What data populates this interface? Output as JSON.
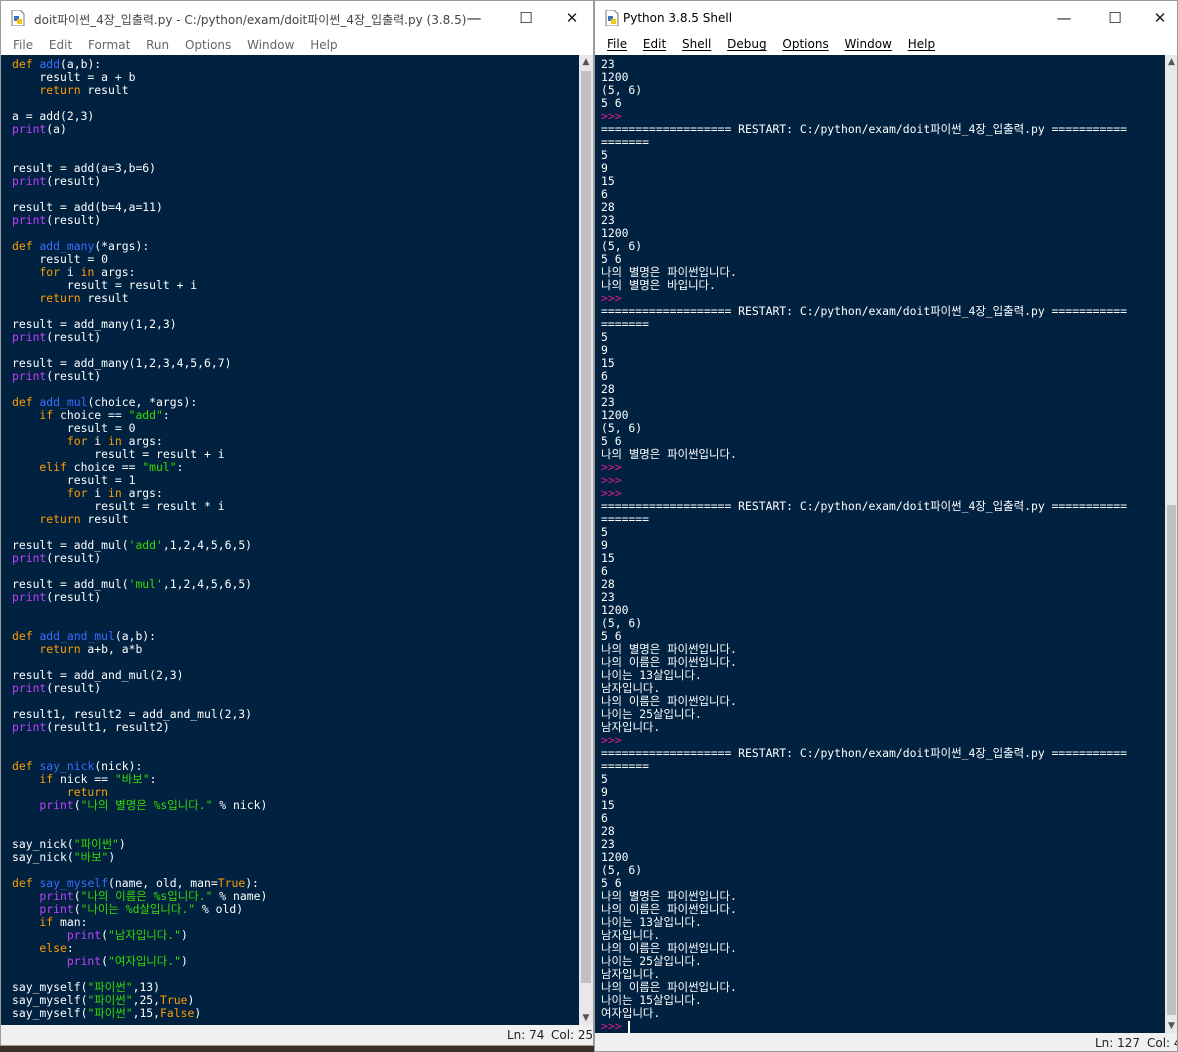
{
  "editor": {
    "title": "doit파이썬_4장_입출력.py - C:/python/exam/doit파이썬_4장_입출력.py (3.8.5)",
    "menu": [
      "File",
      "Edit",
      "Format",
      "Run",
      "Options",
      "Window",
      "Help"
    ],
    "status_ln": "Ln: 74",
    "status_col": "Col: 25",
    "code_lines": [
      [
        [
          "kw",
          "def "
        ],
        [
          "fn",
          "add"
        ],
        [
          "",
          "(a,b):"
        ]
      ],
      [
        [
          "",
          "    result = a + b"
        ]
      ],
      [
        [
          "kw",
          "    return"
        ],
        [
          "",
          " result"
        ]
      ],
      [],
      [
        [
          "",
          "a = add(2,3)"
        ]
      ],
      [
        [
          "bi",
          "print"
        ],
        [
          "",
          "(a)"
        ]
      ],
      [],
      [],
      [
        [
          "",
          "result = add(a=3,b=6)"
        ]
      ],
      [
        [
          "bi",
          "print"
        ],
        [
          "",
          "(result)"
        ]
      ],
      [],
      [
        [
          "",
          "result = add(b=4,a=11)"
        ]
      ],
      [
        [
          "bi",
          "print"
        ],
        [
          "",
          "(result)"
        ]
      ],
      [],
      [
        [
          "kw",
          "def "
        ],
        [
          "fn",
          "add_many"
        ],
        [
          "",
          "(*args):"
        ]
      ],
      [
        [
          "",
          "    result = 0"
        ]
      ],
      [
        [
          "kw",
          "    for"
        ],
        [
          "",
          " i "
        ],
        [
          "kw",
          "in"
        ],
        [
          "",
          " args:"
        ]
      ],
      [
        [
          "",
          "        result = result + i"
        ]
      ],
      [
        [
          "kw",
          "    return"
        ],
        [
          "",
          " result"
        ]
      ],
      [],
      [
        [
          "",
          "result = add_many(1,2,3)"
        ]
      ],
      [
        [
          "bi",
          "print"
        ],
        [
          "",
          "(result)"
        ]
      ],
      [],
      [
        [
          "",
          "result = add_many(1,2,3,4,5,6,7)"
        ]
      ],
      [
        [
          "bi",
          "print"
        ],
        [
          "",
          "(result)"
        ]
      ],
      [],
      [
        [
          "kw",
          "def "
        ],
        [
          "fn",
          "add_mul"
        ],
        [
          "",
          "(choice, *args):"
        ]
      ],
      [
        [
          "kw",
          "    if"
        ],
        [
          "",
          " choice == "
        ],
        [
          "str",
          "\"add\""
        ],
        [
          "",
          ":"
        ]
      ],
      [
        [
          "",
          "        result = 0"
        ]
      ],
      [
        [
          "kw",
          "        for"
        ],
        [
          "",
          " i "
        ],
        [
          "kw",
          "in"
        ],
        [
          "",
          " args:"
        ]
      ],
      [
        [
          "",
          "            result = result + i"
        ]
      ],
      [
        [
          "kw",
          "    elif"
        ],
        [
          "",
          " choice == "
        ],
        [
          "str",
          "\"mul\""
        ],
        [
          "",
          ":"
        ]
      ],
      [
        [
          "",
          "        result = 1"
        ]
      ],
      [
        [
          "kw",
          "        for"
        ],
        [
          "",
          " i "
        ],
        [
          "kw",
          "in"
        ],
        [
          "",
          " args:"
        ]
      ],
      [
        [
          "",
          "            result = result * i"
        ]
      ],
      [
        [
          "kw",
          "    return"
        ],
        [
          "",
          " result"
        ]
      ],
      [],
      [
        [
          "",
          "result = add_mul("
        ],
        [
          "str",
          "'add'"
        ],
        [
          "",
          ",1,2,4,5,6,5)"
        ]
      ],
      [
        [
          "bi",
          "print"
        ],
        [
          "",
          "(result)"
        ]
      ],
      [],
      [
        [
          "",
          "result = add_mul("
        ],
        [
          "str",
          "'mul'"
        ],
        [
          "",
          ",1,2,4,5,6,5)"
        ]
      ],
      [
        [
          "bi",
          "print"
        ],
        [
          "",
          "(result)"
        ]
      ],
      [],
      [],
      [
        [
          "kw",
          "def "
        ],
        [
          "fn",
          "add_and_mul"
        ],
        [
          "",
          "(a,b):"
        ]
      ],
      [
        [
          "kw",
          "    return"
        ],
        [
          "",
          " a+b, a*b"
        ]
      ],
      [],
      [
        [
          "",
          "result = add_and_mul(2,3)"
        ]
      ],
      [
        [
          "bi",
          "print"
        ],
        [
          "",
          "(result)"
        ]
      ],
      [],
      [
        [
          "",
          "result1, result2 = add_and_mul(2,3)"
        ]
      ],
      [
        [
          "bi",
          "print"
        ],
        [
          "",
          "(result1, result2)"
        ]
      ],
      [],
      [],
      [
        [
          "kw",
          "def "
        ],
        [
          "fn",
          "say_nick"
        ],
        [
          "",
          "(nick):"
        ]
      ],
      [
        [
          "kw",
          "    if"
        ],
        [
          "",
          " nick == "
        ],
        [
          "str",
          "\"바보\""
        ],
        [
          "",
          ":"
        ]
      ],
      [
        [
          "kw",
          "        return"
        ]
      ],
      [
        [
          "bi",
          "    print"
        ],
        [
          "",
          "("
        ],
        [
          "str",
          "\"나의 별명은 %s입니다.\""
        ],
        [
          "",
          " % nick)"
        ]
      ],
      [],
      [],
      [
        [
          "",
          "say_nick("
        ],
        [
          "str",
          "\"파이썬\""
        ],
        [
          "",
          ")"
        ]
      ],
      [
        [
          "",
          "say_nick("
        ],
        [
          "str",
          "\"바보\""
        ],
        [
          "",
          ")"
        ]
      ],
      [],
      [
        [
          "kw",
          "def "
        ],
        [
          "fn",
          "say_myself"
        ],
        [
          "",
          "(name, old, man="
        ],
        [
          "kw",
          "True"
        ],
        [
          "",
          "):"
        ]
      ],
      [
        [
          "bi",
          "    print"
        ],
        [
          "",
          "("
        ],
        [
          "str",
          "\"나의 이름은 %s입니다.\""
        ],
        [
          "",
          " % name)"
        ]
      ],
      [
        [
          "bi",
          "    print"
        ],
        [
          "",
          "("
        ],
        [
          "str",
          "\"나이는 %d살입니다.\""
        ],
        [
          "",
          " % old)"
        ]
      ],
      [
        [
          "kw",
          "    if"
        ],
        [
          "",
          " man:"
        ]
      ],
      [
        [
          "bi",
          "        print"
        ],
        [
          "",
          "("
        ],
        [
          "str",
          "\"남자입니다.\""
        ],
        [
          "",
          ")"
        ]
      ],
      [
        [
          "kw",
          "    else"
        ],
        [
          "",
          ":"
        ]
      ],
      [
        [
          "bi",
          "        print"
        ],
        [
          "",
          "("
        ],
        [
          "str",
          "\"여자입니다.\""
        ],
        [
          "",
          ")"
        ]
      ],
      [],
      [
        [
          "",
          "say_myself("
        ],
        [
          "str",
          "\"파이썬\""
        ],
        [
          "",
          ",13)"
        ]
      ],
      [
        [
          "",
          "say_myself("
        ],
        [
          "str",
          "\"파이썬\""
        ],
        [
          "",
          ",25,"
        ],
        [
          "kw",
          "True"
        ],
        [
          "",
          ")"
        ]
      ],
      [
        [
          "",
          "say_myself("
        ],
        [
          "str",
          "\"파이썬\""
        ],
        [
          "",
          ",15,"
        ],
        [
          "kw",
          "False"
        ],
        [
          "",
          ")"
        ]
      ]
    ]
  },
  "shell": {
    "title": "Python 3.8.5 Shell",
    "menu": [
      "File",
      "Edit",
      "Shell",
      "Debug",
      "Options",
      "Window",
      "Help"
    ],
    "status_ln": "Ln: 127",
    "status_col": "Col: 4",
    "output_lines": [
      [
        [
          "",
          "23"
        ]
      ],
      [
        [
          "",
          "1200"
        ]
      ],
      [
        [
          "",
          "(5, 6)"
        ]
      ],
      [
        [
          "",
          "5 6"
        ]
      ],
      [
        [
          "prompt",
          ">>>"
        ]
      ],
      [
        [
          "restart",
          "=================== RESTART: C:/python/exam/doit파이썬_4장_입출력.py ==========="
        ]
      ],
      [
        [
          "restart",
          "======="
        ]
      ],
      [
        [
          "",
          "5"
        ]
      ],
      [
        [
          "",
          "9"
        ]
      ],
      [
        [
          "",
          "15"
        ]
      ],
      [
        [
          "",
          "6"
        ]
      ],
      [
        [
          "",
          "28"
        ]
      ],
      [
        [
          "",
          "23"
        ]
      ],
      [
        [
          "",
          "1200"
        ]
      ],
      [
        [
          "",
          "(5, 6)"
        ]
      ],
      [
        [
          "",
          "5 6"
        ]
      ],
      [
        [
          "",
          "나의 별명은 파이썬입니다."
        ]
      ],
      [
        [
          "",
          "나의 별명은 바입니다."
        ]
      ],
      [
        [
          "prompt",
          ">>>"
        ]
      ],
      [
        [
          "restart",
          "=================== RESTART: C:/python/exam/doit파이썬_4장_입출력.py ==========="
        ]
      ],
      [
        [
          "restart",
          "======="
        ]
      ],
      [
        [
          "",
          "5"
        ]
      ],
      [
        [
          "",
          "9"
        ]
      ],
      [
        [
          "",
          "15"
        ]
      ],
      [
        [
          "",
          "6"
        ]
      ],
      [
        [
          "",
          "28"
        ]
      ],
      [
        [
          "",
          "23"
        ]
      ],
      [
        [
          "",
          "1200"
        ]
      ],
      [
        [
          "",
          "(5, 6)"
        ]
      ],
      [
        [
          "",
          "5 6"
        ]
      ],
      [
        [
          "",
          "나의 별명은 파이썬입니다."
        ]
      ],
      [
        [
          "prompt",
          ">>>"
        ]
      ],
      [
        [
          "prompt",
          ">>>"
        ]
      ],
      [
        [
          "prompt",
          ">>>"
        ]
      ],
      [
        [
          "restart",
          "=================== RESTART: C:/python/exam/doit파이썬_4장_입출력.py ==========="
        ]
      ],
      [
        [
          "restart",
          "======="
        ]
      ],
      [
        [
          "",
          "5"
        ]
      ],
      [
        [
          "",
          "9"
        ]
      ],
      [
        [
          "",
          "15"
        ]
      ],
      [
        [
          "",
          "6"
        ]
      ],
      [
        [
          "",
          "28"
        ]
      ],
      [
        [
          "",
          "23"
        ]
      ],
      [
        [
          "",
          "1200"
        ]
      ],
      [
        [
          "",
          "(5, 6)"
        ]
      ],
      [
        [
          "",
          "5 6"
        ]
      ],
      [
        [
          "",
          "나의 별명은 파이썬입니다."
        ]
      ],
      [
        [
          "",
          "나의 이름은 파이썬입니다."
        ]
      ],
      [
        [
          "",
          "나이는 13살입니다."
        ]
      ],
      [
        [
          "",
          "남자입니다."
        ]
      ],
      [
        [
          "",
          "나의 이름은 파이썬입니다."
        ]
      ],
      [
        [
          "",
          "나이는 25살입니다."
        ]
      ],
      [
        [
          "",
          "남자입니다."
        ]
      ],
      [
        [
          "prompt",
          ">>>"
        ]
      ],
      [
        [
          "restart",
          "=================== RESTART: C:/python/exam/doit파이썬_4장_입출력.py ==========="
        ]
      ],
      [
        [
          "restart",
          "======="
        ]
      ],
      [
        [
          "",
          "5"
        ]
      ],
      [
        [
          "",
          "9"
        ]
      ],
      [
        [
          "",
          "15"
        ]
      ],
      [
        [
          "",
          "6"
        ]
      ],
      [
        [
          "",
          "28"
        ]
      ],
      [
        [
          "",
          "23"
        ]
      ],
      [
        [
          "",
          "1200"
        ]
      ],
      [
        [
          "",
          "(5, 6)"
        ]
      ],
      [
        [
          "",
          "5 6"
        ]
      ],
      [
        [
          "",
          "나의 별명은 파이썬입니다."
        ]
      ],
      [
        [
          "",
          "나의 이름은 파이썬입니다."
        ]
      ],
      [
        [
          "",
          "나이는 13살입니다."
        ]
      ],
      [
        [
          "",
          "남자입니다."
        ]
      ],
      [
        [
          "",
          "나의 이름은 파이썬입니다."
        ]
      ],
      [
        [
          "",
          "나이는 25살입니다."
        ]
      ],
      [
        [
          "",
          "남자입니다."
        ]
      ],
      [
        [
          "",
          "나의 이름은 파이썬입니다."
        ]
      ],
      [
        [
          "",
          "나이는 15살입니다."
        ]
      ],
      [
        [
          "",
          "여자입니다."
        ]
      ],
      [
        [
          "prompt",
          ">>> "
        ]
      ]
    ]
  },
  "colors": {
    "code_background": "#002240",
    "keyword": "#ff9d00",
    "builtin": "#c040ff",
    "string": "#3ad900",
    "function_name": "#3a6cff",
    "prompt": "#d91e8c"
  },
  "icons": {
    "editor_icon": "python-file-icon",
    "shell_icon": "python-file-icon",
    "minimize": "minimize-icon",
    "maximize": "maximize-icon",
    "close": "close-icon"
  }
}
